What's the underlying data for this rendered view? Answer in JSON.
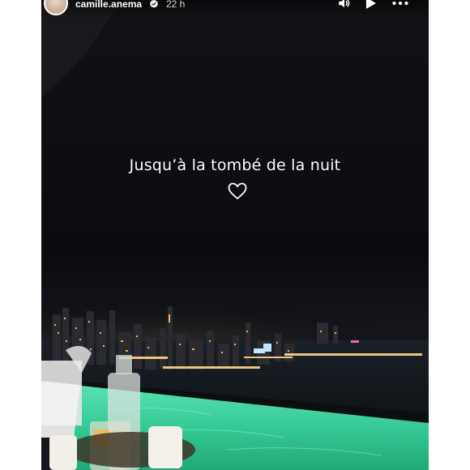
{
  "story": {
    "username": "camille.anema",
    "timestamp": "22 h",
    "verified": true,
    "caption": "Jusqu’à la tombé de la nuit",
    "caption_sticker_icon": "heart-outline-icon",
    "controls": {
      "volume_icon": "volume-icon",
      "play_icon": "play-icon",
      "more_icon": "more-options-icon"
    }
  },
  "colors": {
    "sky": "#0d0d10",
    "pool_water": "#3fd6a4",
    "city_lights": "#f2b64a"
  }
}
